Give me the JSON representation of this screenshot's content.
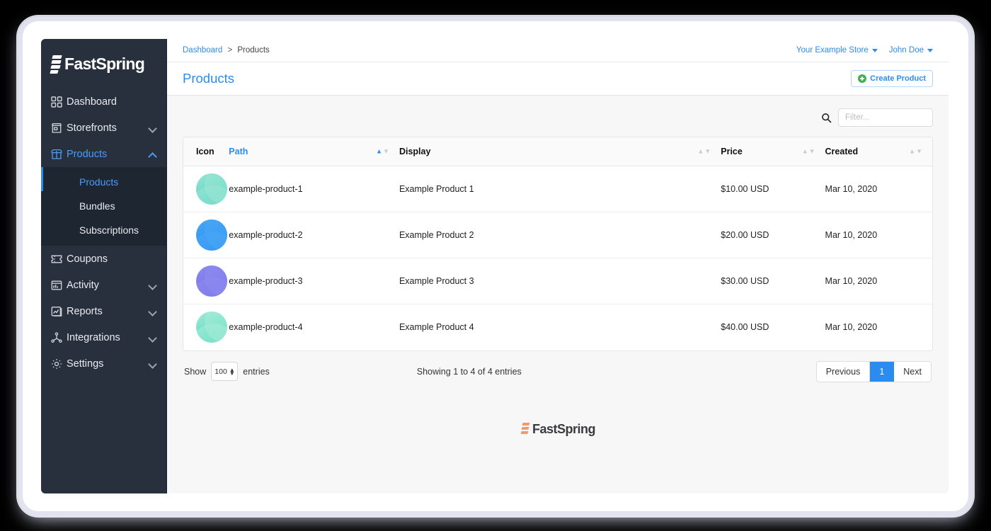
{
  "brand": {
    "name": "FastSpring",
    "mark": "fastspring-logo-mark"
  },
  "sidebar": {
    "items": [
      {
        "label": "Dashboard",
        "icon": "grid-icon",
        "expandable": false,
        "active": false
      },
      {
        "label": "Storefronts",
        "icon": "storefront-icon",
        "expandable": true,
        "active": false
      },
      {
        "label": "Products",
        "icon": "box-open-icon",
        "expandable": true,
        "active": true
      },
      {
        "label": "Coupons",
        "icon": "ticket-icon",
        "expandable": false,
        "active": false
      },
      {
        "label": "Activity",
        "icon": "activity-icon",
        "expandable": true,
        "active": false
      },
      {
        "label": "Reports",
        "icon": "reports-icon",
        "expandable": true,
        "active": false
      },
      {
        "label": "Integrations",
        "icon": "integrations-icon",
        "expandable": true,
        "active": false
      },
      {
        "label": "Settings",
        "icon": "gear-icon",
        "expandable": true,
        "active": false
      }
    ],
    "subitems": [
      {
        "label": "Products",
        "active": true
      },
      {
        "label": "Bundles",
        "active": false
      },
      {
        "label": "Subscriptions",
        "active": false
      }
    ]
  },
  "topbar": {
    "breadcrumb_root": "Dashboard",
    "breadcrumb_sep": ">",
    "breadcrumb_current": "Products",
    "store": "Your Example Store",
    "user": "John Doe"
  },
  "pagehead": {
    "title": "Products",
    "create_label": "Create Product",
    "create_icon": "plus-circle-icon"
  },
  "search": {
    "icon": "search-icon",
    "placeholder": "Filter...",
    "value": ""
  },
  "table": {
    "columns": [
      {
        "label": "Icon",
        "sortable": false,
        "sorted": false
      },
      {
        "label": "Path",
        "sortable": true,
        "sorted": true
      },
      {
        "label": "Display",
        "sortable": true,
        "sorted": false
      },
      {
        "label": "Price",
        "sortable": true,
        "sorted": false
      },
      {
        "label": "Created",
        "sortable": true,
        "sorted": false
      }
    ],
    "rows": [
      {
        "icon": "product-avatar-teal",
        "icon_from": "#9ce5d6",
        "icon_to": "#3fcdb4",
        "path": "example-product-1",
        "display": "Example Product 1",
        "price": "$10.00 USD",
        "created": "Mar 10, 2020"
      },
      {
        "icon": "product-avatar-blue",
        "icon_from": "#4aa8f5",
        "icon_to": "#1e86ef",
        "path": "example-product-2",
        "display": "Example Product 2",
        "price": "$20.00 USD",
        "created": "Mar 10, 2020"
      },
      {
        "icon": "product-avatar-purple",
        "icon_from": "#8e8cf0",
        "icon_to": "#6a66e8",
        "path": "example-product-3",
        "display": "Example Product 3",
        "price": "$30.00 USD",
        "created": "Mar 10, 2020"
      },
      {
        "icon": "product-avatar-green",
        "icon_from": "#a8ecd9",
        "icon_to": "#34cfb2",
        "path": "example-product-4",
        "display": "Example Product 4",
        "price": "$40.00 USD",
        "created": "Mar 10, 2020"
      }
    ]
  },
  "footer": {
    "show_label": "Show",
    "entries_value": "100",
    "entries_label": "entries",
    "showing_info": "Showing 1 to 4 of 4 entries",
    "pagination": {
      "previous": "Previous",
      "current_page": "1",
      "next": "Next"
    },
    "logo_text": "FastSpring"
  },
  "colors": {
    "accent_blue": "#2b8cf0",
    "sidebar_bg": "#28303d",
    "subnav_bg": "#1e2631",
    "green": "#3db24f",
    "logo_orange": "#f29a6e"
  }
}
